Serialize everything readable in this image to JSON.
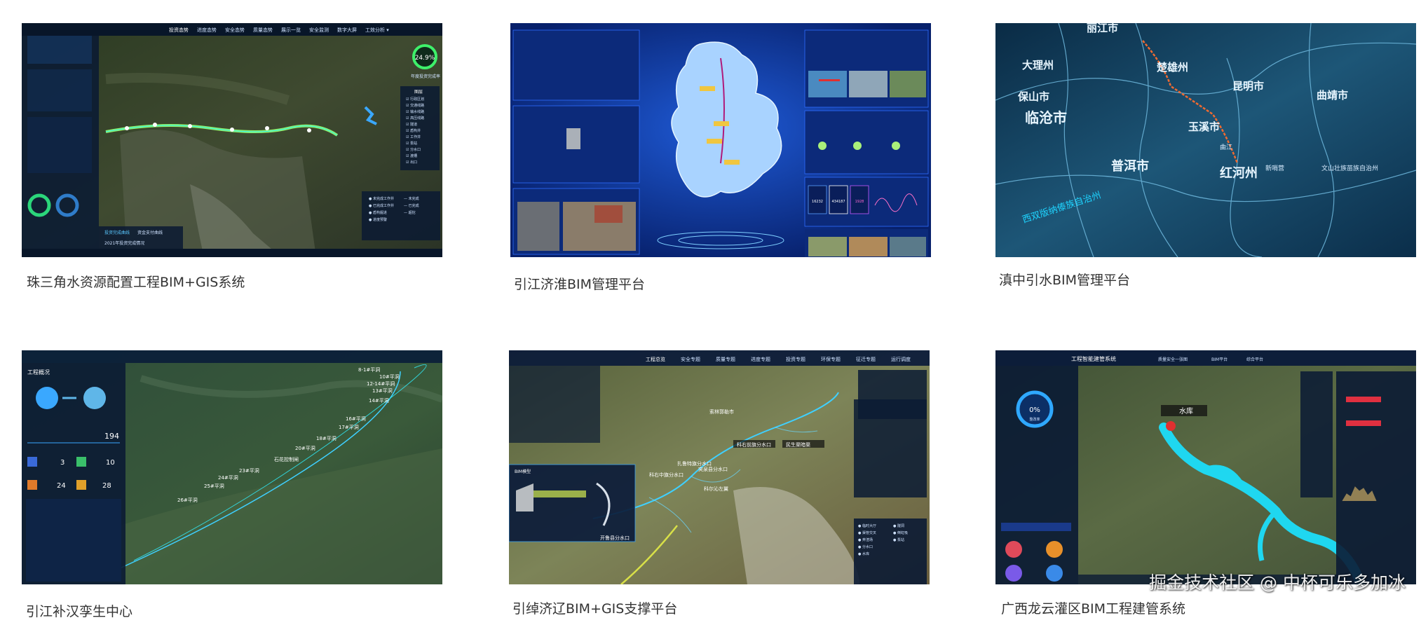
{
  "gallery": {
    "items": [
      {
        "caption": "珠三角水资源配置工程BIM+GIS系统",
        "nav": [
          "投资态势",
          "进度态势",
          "安全态势",
          "质量态势",
          "展示一览",
          "安全监测",
          "数字大屏",
          "工效分析 ▾"
        ],
        "gauge": "24.9%",
        "gauge_label": "年度投资完成率",
        "tabs": [
          "投资完成曲线",
          "资金支付曲线"
        ],
        "bottom_note": "2021年投资完成情况",
        "panel_title": "图层",
        "layers": [
          "行政区划",
          "交通线路",
          "输水线路",
          "高压线路",
          "隧道",
          "盾构井",
          "工作井",
          "泵站",
          "分水口",
          "渡槽",
          "出口"
        ],
        "legend": [
          "未完成工作井",
          "已完成工作井",
          "盾构掘进",
          "未完成",
          "已完成",
          "超挖",
          "进度预警"
        ]
      },
      {
        "caption": "引江济淮BIM管理平台",
        "stats": [
          "16232",
          "434187",
          "1928"
        ]
      },
      {
        "caption": "滇中引水BIM管理平台",
        "places": [
          "丽江市",
          "大理州",
          "保山市",
          "楚雄州",
          "昆明市",
          "曲靖市",
          "临沧市",
          "玉溪市",
          "普洱市",
          "红河州",
          "曲江",
          "新哨营",
          "文山壮族苗族自治州",
          "西双版纳傣族自治州"
        ]
      },
      {
        "caption": "引江补汉孪生中心",
        "left_title": "工程概况",
        "km": "194",
        "counts": [
          "3",
          "10",
          "24",
          "28"
        ],
        "wells": [
          "8-1#平洞",
          "10#平洞",
          "12-14#平洞",
          "13#平洞",
          "14#平洞",
          "16#平洞",
          "17#平洞",
          "18#平洞",
          "20#平洞",
          "石花控制闸",
          "23#平洞",
          "24#平洞",
          "25#平洞",
          "26#平洞"
        ]
      },
      {
        "caption": "引绰济辽BIM+GIS支撑平台",
        "nav": [
          "工程总览",
          "安全专题",
          "质量专题",
          "进度专题",
          "投资专题",
          "环保专题",
          "征迁专题",
          "运行调度"
        ],
        "labels": [
          "索林郭勒市",
          "民生渠暗渠",
          "科右前旗分水口",
          "科右中旗分水口",
          "突泉县分水口",
          "扎鲁特旗分水口",
          "科尔沁左翼",
          "开鲁县分水口"
        ],
        "panel": "BIM模型"
      },
      {
        "caption": "广西龙云灌区BIM工程建管系统",
        "title": "工程智能建管系统",
        "reservoir": "水库",
        "gauge": "0%",
        "gauge_label": "整改率",
        "tabs": [
          "质量安全一张图",
          "BIM平台",
          "综合平台"
        ]
      }
    ]
  },
  "watermark": "掘金技术社区 @ 中杯可乐多加冰"
}
